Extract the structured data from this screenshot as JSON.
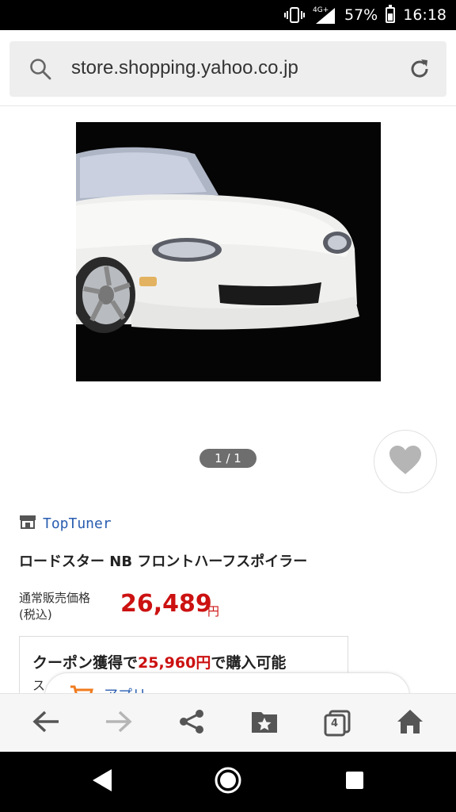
{
  "status_bar": {
    "network": "4G+",
    "battery_percent": "57%",
    "time": "16:18"
  },
  "browser": {
    "url": "store.shopping.yahoo.co.jp",
    "icons": [
      "search-icon",
      "reload-icon"
    ]
  },
  "gallery": {
    "pager": "1 / 1"
  },
  "product": {
    "store_name": "TopTuner",
    "title": "ロードスター NB フロントハーフスポイラー",
    "price_label": "通常販売価格",
    "tax_note": "(税込)",
    "price": "26,489",
    "price_unit": "円",
    "coupon_prefix": "クーポン獲得で",
    "coupon_price": "25,960円",
    "coupon_suffix": "で購入可能",
    "coupon_sub": "ス"
  },
  "app_banner": {
    "text": "アプリ..."
  },
  "toolbar": {
    "tabs_count": "4"
  },
  "colors": {
    "price_red": "#cc1111",
    "link_blue": "#2a5db0"
  }
}
